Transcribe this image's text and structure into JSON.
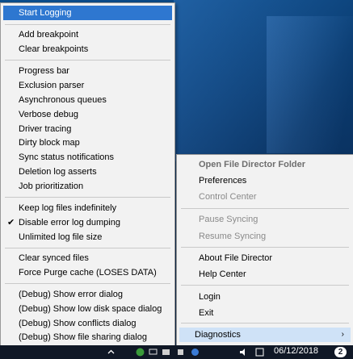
{
  "main_menu": {
    "items": [
      {
        "label": "Start Logging"
      },
      {
        "label": "Add breakpoint"
      },
      {
        "label": "Clear breakpoints"
      },
      {
        "label": "Progress bar"
      },
      {
        "label": "Exclusion parser"
      },
      {
        "label": "Asynchronous queues"
      },
      {
        "label": "Verbose debug"
      },
      {
        "label": "Driver tracing"
      },
      {
        "label": "Dirty block map"
      },
      {
        "label": "Sync status notifications"
      },
      {
        "label": "Deletion log asserts"
      },
      {
        "label": "Job prioritization"
      },
      {
        "label": "Keep log files indefinitely"
      },
      {
        "label": "Disable error log dumping",
        "checked": true
      },
      {
        "label": "Unlimited log file size"
      },
      {
        "label": "Clear synced files"
      },
      {
        "label": "Force Purge cache (LOSES DATA)"
      },
      {
        "label": "(Debug) Show error dialog"
      },
      {
        "label": "(Debug) Show low disk space dialog"
      },
      {
        "label": "(Debug) Show conflicts dialog"
      },
      {
        "label": "(Debug) Show file sharing dialog"
      }
    ]
  },
  "sub_menu": {
    "items": [
      {
        "label": "Open File Director Folder"
      },
      {
        "label": "Preferences"
      },
      {
        "label": "Control Center"
      },
      {
        "label": "Pause Syncing"
      },
      {
        "label": "Resume Syncing"
      },
      {
        "label": "About File Director"
      },
      {
        "label": "Help Center"
      },
      {
        "label": "Login"
      },
      {
        "label": "Exit"
      },
      {
        "label": "Diagnostics"
      }
    ]
  },
  "taskbar": {
    "clock_date": "06/12/2018",
    "notification_count": "2"
  },
  "colors": {
    "highlight": "#2e77d0",
    "menu_bg": "#f2f2f2",
    "disabled_text": "#8a8a8a"
  }
}
